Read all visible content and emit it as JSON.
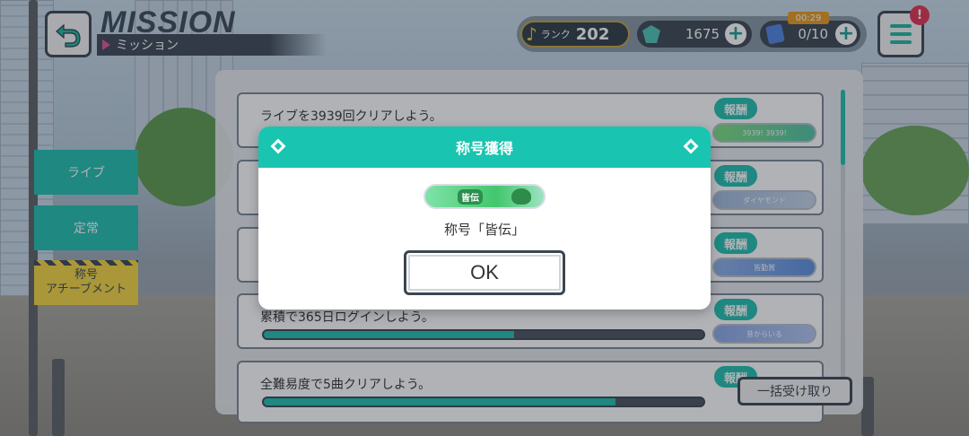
{
  "header": {
    "title": "MISSION",
    "subtitle": "ミッション"
  },
  "status": {
    "rank_label": "ランク",
    "rank_value": "202",
    "gems": "1675",
    "tickets": "0/10",
    "timer": "00:29",
    "alert": "!"
  },
  "tabs": [
    {
      "label": "ライブ"
    },
    {
      "label": "定常"
    },
    {
      "label": "称号\nアチーブメント"
    }
  ],
  "missions": [
    {
      "text": "ライブを3939回クリアしよう。",
      "reward_label": "報酬",
      "reward_plate": "3939! 3939!",
      "progress": null
    },
    {
      "text": "",
      "reward_label": "報酬",
      "reward_plate": "ダイヤモンド",
      "progress": null
    },
    {
      "text": "",
      "reward_label": "報酬",
      "reward_plate": "皆勤賞",
      "progress": null
    },
    {
      "text": "累積で365日ログインしよう。",
      "reward_label": "報酬",
      "reward_plate": "昔からいる",
      "progress": 0.57
    },
    {
      "text": "全難易度で5曲クリアしよう。",
      "reward_label": "報酬",
      "reward_plate": "",
      "progress": 0.8
    }
  ],
  "collect_all_label": "一括受け取り",
  "dialog": {
    "title": "称号獲得",
    "plate_chip": "皆伝",
    "message": "称号「皆伝」",
    "ok_label": "OK"
  },
  "icons": {
    "back": "back-arrow-icon",
    "rank": "music-note-icon",
    "gem": "gem-icon",
    "ticket": "ticket-icon",
    "plus": "plus-icon",
    "menu": "hamburger-menu-icon"
  },
  "colors": {
    "accent": "#1fbfae",
    "tab_highlight": "#f4d640",
    "dark": "#3b4650"
  }
}
